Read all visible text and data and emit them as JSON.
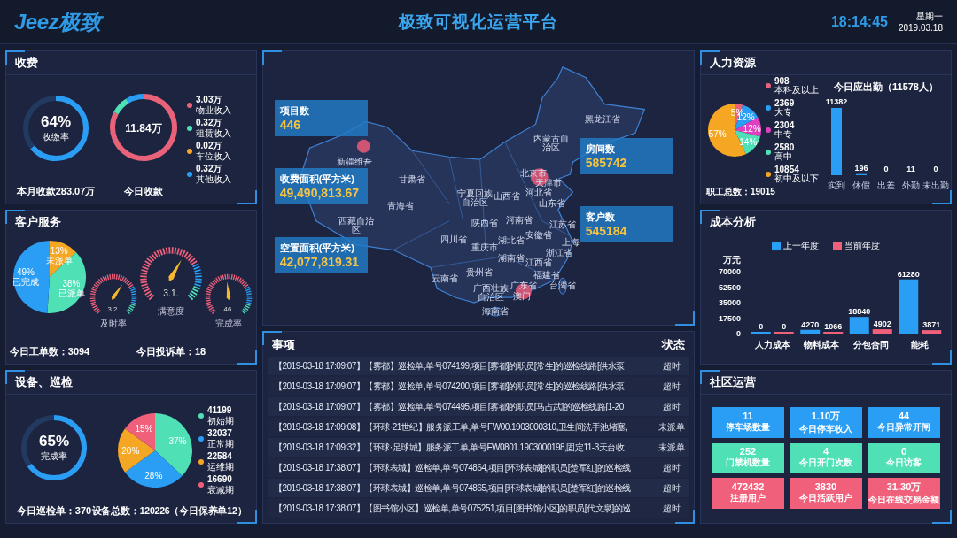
{
  "header": {
    "logo": "Jeez极致",
    "title": "极致可视化运营平台",
    "time": "18:14:45",
    "weekday": "星期一",
    "date": "2019.03.18"
  },
  "fees": {
    "title": "收费",
    "ring": {
      "value": "64%",
      "label": "收缴率",
      "level": 0.64
    },
    "ring_caption": "本月收款283.07万",
    "donut": {
      "center": "11.84万",
      "chart_data": {
        "type": "donut",
        "values": [
          82.6,
          8.7,
          8.7
        ],
        "colors": [
          "#e8637a",
          "#4fe0b6",
          "#2a9df4"
        ]
      }
    },
    "donut_caption": "今日收款",
    "legend": [
      {
        "value": "3.03万",
        "label": "物业收入",
        "color": "#e8637a"
      },
      {
        "value": "0.32万",
        "label": "租赁收入",
        "color": "#4fe0b6"
      },
      {
        "value": "0.02万",
        "label": "车位收入",
        "color": "#f5a623"
      },
      {
        "value": "0.32万",
        "label": "其他收入",
        "color": "#2a9df4"
      }
    ]
  },
  "customer_service": {
    "title": "客户服务",
    "pie": {
      "chart_data": {
        "type": "pie",
        "categories": [
          "未派单",
          "已派单",
          "已完成"
        ],
        "values": [
          13,
          38,
          49
        ],
        "value_labels": [
          "13%",
          "38%",
          "49%"
        ],
        "colors": [
          "#f5a623",
          "#4fe0b6",
          "#2a9df4"
        ]
      }
    },
    "gauges": [
      {
        "reading": "3.2.",
        "label": "及时率",
        "level": 0.63
      },
      {
        "reading": "3.1.",
        "label": "满意度",
        "level": 0.61
      },
      {
        "reading": "46.",
        "label": "完成率",
        "level": 0.48
      }
    ],
    "work_orders": "今日工单数：3094",
    "complaints": "今日投诉单：18"
  },
  "equipment": {
    "title": "设备、巡检",
    "ring": {
      "value": "65%",
      "label": "完成率",
      "level": 0.65
    },
    "ring_caption": "今日巡检单：370",
    "pie": {
      "chart_data": {
        "type": "pie",
        "values": [
          37,
          28,
          20,
          15
        ],
        "value_labels": [
          "37%",
          "28%",
          "20%",
          "15%"
        ],
        "colors": [
          "#4fe0b6",
          "#2a9df4",
          "#f5a623",
          "#f0607a"
        ]
      }
    },
    "legend": [
      {
        "value": "41199",
        "label": "初始期",
        "color": "#4fe0b6"
      },
      {
        "value": "32037",
        "label": "正常期",
        "color": "#2a9df4"
      },
      {
        "value": "22584",
        "label": "运维期",
        "color": "#f5a623"
      },
      {
        "value": "16690",
        "label": "衰减期",
        "color": "#f0607a"
      }
    ],
    "pie_caption": "设备总数：120226（今日保养单12）"
  },
  "map": {
    "left_stats": [
      {
        "label": "项目数",
        "value": "446"
      },
      {
        "label": "收费面积(平方米)",
        "value": "49,490,813.67"
      },
      {
        "label": "空置面积(平方米)",
        "value": "42,077,819.31"
      }
    ],
    "right_stats": [
      {
        "label": "房间数",
        "value": "585742"
      },
      {
        "label": "客户数",
        "value": "545184"
      }
    ],
    "regions": [
      "黑龙江省",
      "内蒙古自治区",
      "新疆维吾",
      "甘肃省",
      "北京市",
      "天津市",
      "青海省",
      "宁夏回族自治区",
      "山西省",
      "河北省",
      "山东省",
      "西藏自治区",
      "陕西省",
      "河南省",
      "江苏省",
      "四川省",
      "重庆市",
      "湖北省",
      "安徽省",
      "上海",
      "湖南省",
      "江西省",
      "浙江省",
      "云南省",
      "贵州省",
      "福建省",
      "广西壮族自治区",
      "广东省",
      "台湾省",
      "澳门",
      "海南省"
    ]
  },
  "events": {
    "columns": [
      "事项",
      "状态"
    ],
    "rows": [
      {
        "text": "【2019-03-18 17:09:07】【雾都】巡检单,单号074199,项目[雾都]的职员[常生]的巡检线路[供水泵",
        "status": "超时"
      },
      {
        "text": "【2019-03-18 17:09:07】【雾都】巡检单,单号074200,项目[雾都]的职员[常生]的巡检线路[供水泵",
        "status": "超时"
      },
      {
        "text": "【2019-03-18 17:09:07】【雾都】巡检单,单号074495,项目[雾都]的职员[马占武]的巡检线路[1-20",
        "status": "超时"
      },
      {
        "text": "【2019-03-18 17:09:08】【环球·21世纪】服务派工单,单号FW00.1903000310,卫生间洗手池堵塞,",
        "status": "未派单"
      },
      {
        "text": "【2019-03-18 17:09:32】【环球·足球城】服务派工单,单号FW0801.1903000198,固定11-3天台收",
        "status": "未派单"
      },
      {
        "text": "【2019-03-18 17:38:07】【环球表城】巡检单,单号074864,项目[环球表城]的职员[楚军红]的巡检线",
        "status": "超时"
      },
      {
        "text": "【2019-03-18 17:38:07】【环球表城】巡检单,单号074865,项目[环球表城]的职员[楚军红]的巡检线",
        "status": "超时"
      },
      {
        "text": "【2019-03-18 17:38:07】【图书馆小区】巡检单,单号075251,项目[图书馆小区]的职员[代文泉]的巡",
        "status": "超时"
      }
    ]
  },
  "hr": {
    "title": "人力资源",
    "pie": {
      "chart_data": {
        "type": "pie",
        "values": [
          5,
          12,
          12,
          14,
          57
        ],
        "value_labels": [
          "5%",
          "12%",
          "12%",
          "14%",
          "57%"
        ],
        "colors": [
          "#e8637a",
          "#2a9df4",
          "#e040c0",
          "#4fe0b6",
          "#f5a623"
        ]
      }
    },
    "legend": [
      {
        "value": "908",
        "label": "本科及以上",
        "color": "#e8637a"
      },
      {
        "value": "2369",
        "label": "大专",
        "color": "#2a9df4"
      },
      {
        "value": "2304",
        "label": "中专",
        "color": "#e040c0"
      },
      {
        "value": "2580",
        "label": "高中",
        "color": "#4fe0b6"
      },
      {
        "value": "10854",
        "label": "初中及以下",
        "color": "#f5a623"
      }
    ],
    "total": "职工总数：19015",
    "attendance": {
      "chart_data": {
        "type": "bar",
        "title": "今日应出勤（11578人）",
        "categories": [
          "实到",
          "休假",
          "出差",
          "外勤",
          "未出勤"
        ],
        "series": [
          {
            "color": "#2a9df4",
            "values": [
              11382,
              196,
              0,
              11,
              0
            ]
          }
        ],
        "data_labels": true
      }
    }
  },
  "cost": {
    "title": "成本分析",
    "chart_data": {
      "type": "bar",
      "ylabel": "万元",
      "categories": [
        "人力成本",
        "物料成本",
        "分包合同",
        "能耗"
      ],
      "series": [
        {
          "name": "上一年度",
          "color": "#2a9df4",
          "values": [
            0,
            4270,
            18840,
            61280
          ]
        },
        {
          "name": "当前年度",
          "color": "#f0607a",
          "values": [
            0,
            1066,
            4902,
            3871
          ]
        }
      ],
      "ylim": [
        0,
        70000
      ],
      "yticks": [
        0,
        17500,
        35000,
        52500,
        70000
      ],
      "data_labels": true
    }
  },
  "community": {
    "title": "社区运营",
    "tiles": [
      {
        "value": "11",
        "label": "停车场数量",
        "color": "#2a9df4"
      },
      {
        "value": "1.10万",
        "label": "今日停车收入",
        "color": "#2a9df4"
      },
      {
        "value": "44",
        "label": "今日异常开闸",
        "color": "#2a9df4"
      },
      {
        "value": "252",
        "label": "门禁机数量",
        "color": "#4fe0b6"
      },
      {
        "value": "4",
        "label": "今日开门次数",
        "color": "#4fe0b6"
      },
      {
        "value": "0",
        "label": "今日访客",
        "color": "#4fe0b6"
      },
      {
        "value": "472432",
        "label": "注册用户",
        "color": "#f0607a"
      },
      {
        "value": "3830",
        "label": "今日活跃用户",
        "color": "#f0607a"
      },
      {
        "value": "31.30万",
        "label": "今日在线交易金额",
        "color": "#f0607a"
      }
    ]
  }
}
